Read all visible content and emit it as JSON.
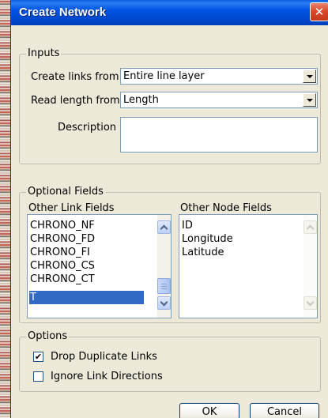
{
  "dialog": {
    "title": "Create Network",
    "close_glyph": "✕"
  },
  "inputs": {
    "legend": "Inputs",
    "create_links_label": "Create links from",
    "create_links_value": "Entire line layer",
    "read_length_label": "Read length from",
    "read_length_value": "Length",
    "description_label": "Description",
    "description_value": ""
  },
  "optional_fields": {
    "legend": "Optional Fields",
    "link_fields_label": "Other Link Fields",
    "link_fields_items": [
      "CHRONO_NF",
      "CHRONO_FD",
      "CHRONO_FI",
      "CHRONO_CS",
      "CHRONO_CT",
      "T"
    ],
    "link_fields_selected": "T",
    "node_fields_label": "Other Node Fields",
    "node_fields_items": [
      "ID",
      "Longitude",
      "Latitude"
    ]
  },
  "options": {
    "legend": "Options",
    "drop_duplicates_label": "Drop Duplicate Links",
    "drop_duplicates_checked": true,
    "ignore_directions_label": "Ignore Link Directions",
    "ignore_directions_checked": false
  },
  "buttons": {
    "ok": "OK",
    "cancel": "Cancel"
  },
  "icons": {
    "close": "close-icon",
    "dropdown": "chevron-down-icon",
    "scroll_up": "chevron-up-icon",
    "scroll_down": "chevron-down-icon",
    "checkmark": "checkmark-icon"
  },
  "colors": {
    "title_bar": "#0054e3",
    "selection": "#316ac5",
    "dialog_bg": "#ece9d8"
  }
}
